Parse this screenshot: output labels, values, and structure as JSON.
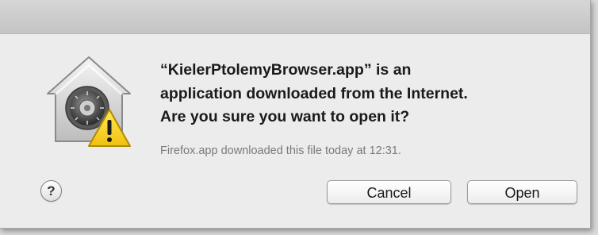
{
  "dialog": {
    "message_lines": [
      "“KielerPtolemyBrowser.app” is an",
      "application downloaded from the Internet.",
      "Are you sure you want to open it?"
    ],
    "info": "Firefox.app downloaded this file today at 12:31.",
    "help_label": "?",
    "buttons": {
      "cancel": "Cancel",
      "open": "Open"
    },
    "icon": "gatekeeper-warning-icon"
  },
  "colors": {
    "dialog_background": "#ececec",
    "info_text": "#7a7a7a",
    "warning_yellow": "#f5d21f"
  }
}
